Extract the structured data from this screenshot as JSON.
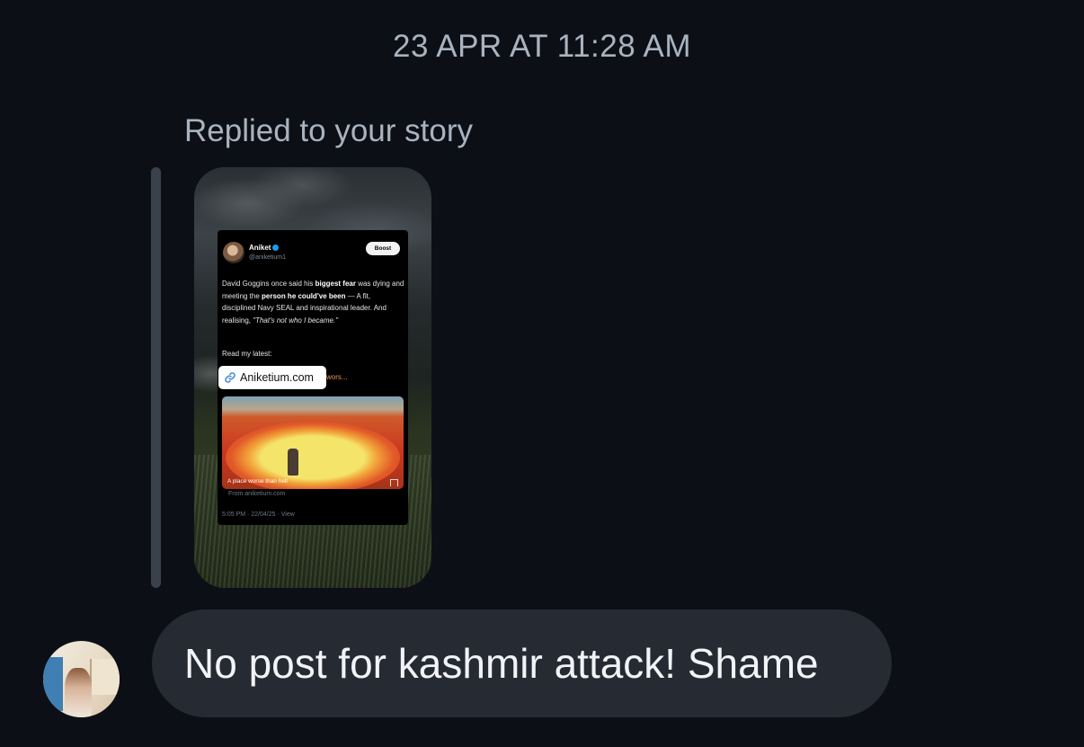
{
  "timestamp": "23 APR AT 11:28 AM",
  "reply_context": {
    "label": "Replied to your story"
  },
  "story": {
    "post": {
      "author_name": "Aniket",
      "author_handle": "@aniketium1",
      "boost_label": "Boost",
      "body_segments": [
        {
          "text": "David Goggins once said his ",
          "style": "normal"
        },
        {
          "text": "biggest fear",
          "style": "bold"
        },
        {
          "text": " was dying and meeting the ",
          "style": "normal"
        },
        {
          "text": "person he could've been",
          "style": "bold"
        },
        {
          "text": " — A fit, disciplined Navy SEAL and inspirational leader. And realising, ",
          "style": "normal"
        },
        {
          "text": "\"That's not who I became.\"",
          "style": "italic"
        }
      ],
      "read_label": "Read my latest:",
      "more_text": "wors...",
      "image_caption": "A place worse than hell",
      "source": "From aniketium.com",
      "meta": "5:05 PM · 22/04/25 · View"
    },
    "link_sticker": {
      "text": "Aniketium.com",
      "icon": "link-icon"
    }
  },
  "message": {
    "text": "No post for kashmir attack! Shame"
  },
  "colors": {
    "background": "#0c1016",
    "bubble": "#262a33",
    "secondary_text": "#a9b3c0",
    "verified": "#1d9bf0"
  }
}
